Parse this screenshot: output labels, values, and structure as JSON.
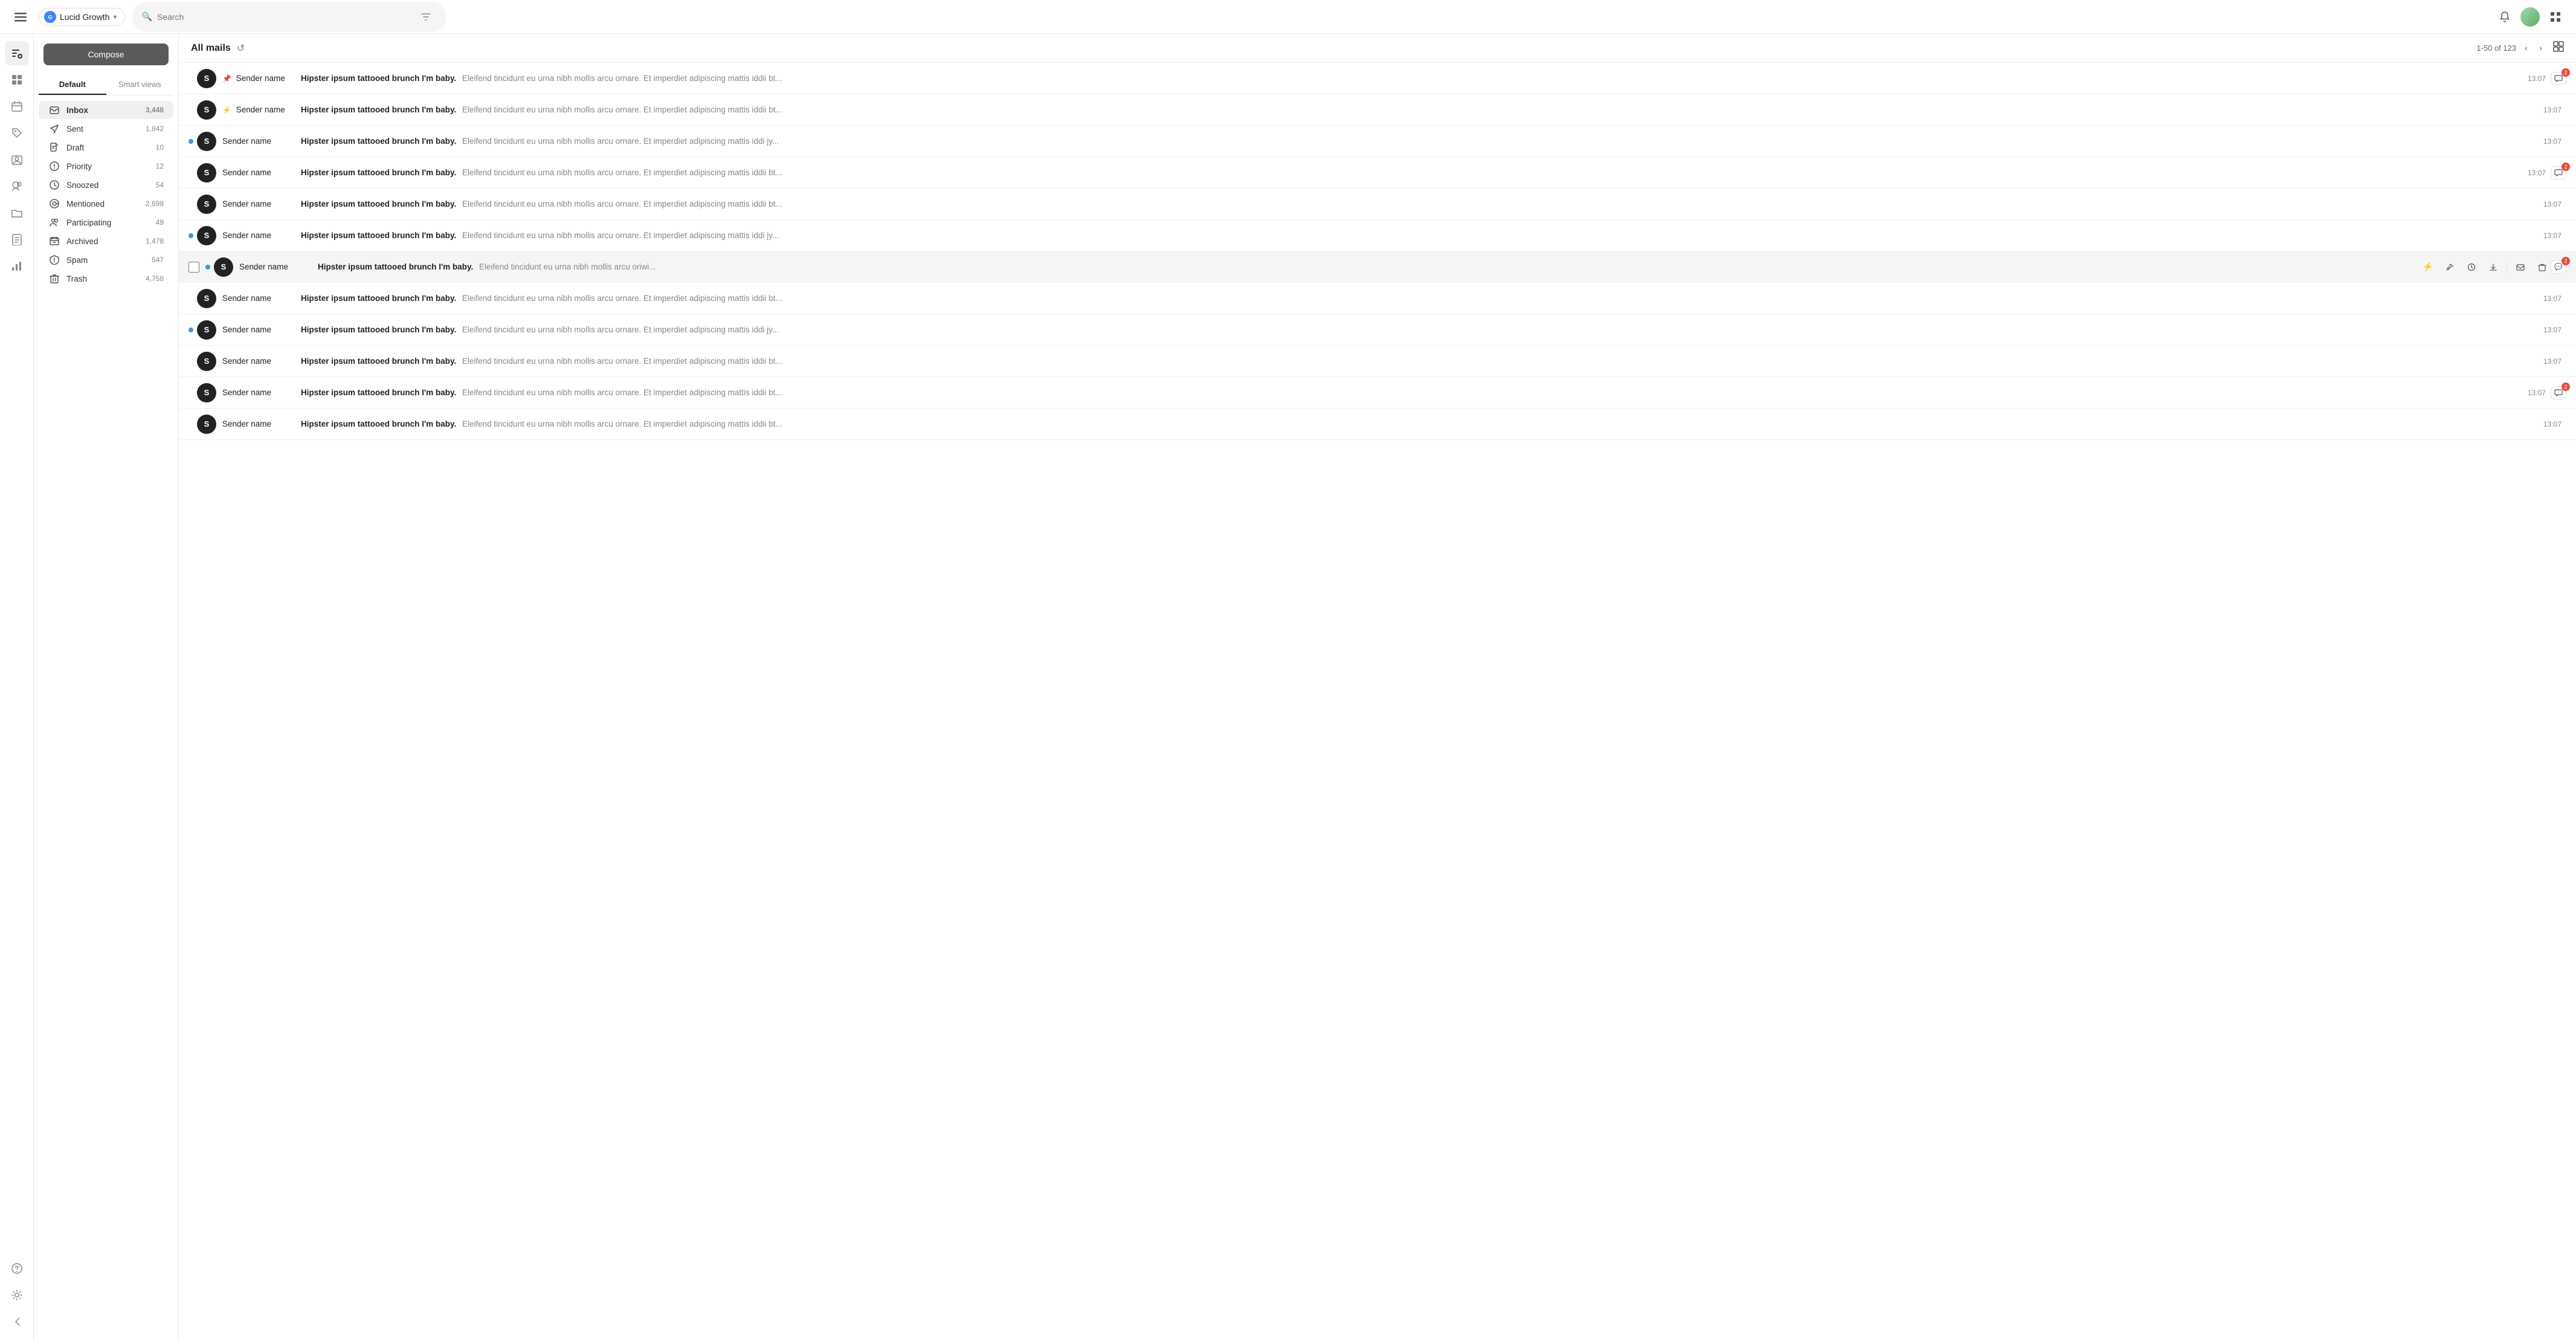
{
  "app": {
    "workspace_name": "Lucid Growth",
    "workspace_logo": "G"
  },
  "topbar": {
    "search_placeholder": "Search",
    "pagination_text": "1-50 of 123"
  },
  "sidebar": {
    "compose_label": "Compose",
    "tabs": [
      {
        "id": "default",
        "label": "Default",
        "active": true
      },
      {
        "id": "smart",
        "label": "Smart views",
        "active": false
      }
    ],
    "nav_items": [
      {
        "id": "inbox",
        "label": "Inbox",
        "count": "3,448",
        "icon": "inbox"
      },
      {
        "id": "sent",
        "label": "Sent",
        "count": "1,842",
        "icon": "sent"
      },
      {
        "id": "draft",
        "label": "Draft",
        "count": "10",
        "icon": "draft"
      },
      {
        "id": "priority",
        "label": "Priority",
        "count": "12",
        "icon": "priority"
      },
      {
        "id": "snoozed",
        "label": "Snoozed",
        "count": "54",
        "icon": "snoozed"
      },
      {
        "id": "mentioned",
        "label": "Mentioned",
        "count": "2,698",
        "icon": "mentioned"
      },
      {
        "id": "participating",
        "label": "Participating",
        "count": "49",
        "icon": "participating"
      },
      {
        "id": "archived",
        "label": "Archived",
        "count": "1,478",
        "icon": "archived"
      },
      {
        "id": "spam",
        "label": "Spam",
        "count": "547",
        "icon": "spam"
      },
      {
        "id": "trash",
        "label": "Trash",
        "count": "4,758",
        "icon": "trash"
      }
    ]
  },
  "mail_list": {
    "title": "All mails",
    "emails": [
      {
        "id": 1,
        "sender": "Sender name",
        "subject": "Hipster ipsum tattooed brunch I'm baby.",
        "preview": "Eleifend tincidunt eu urna nibh mollis arcu ornare. Et imperdiet adipiscing mattis iddii bt...",
        "time": "13:07",
        "unread": false,
        "pinned": true,
        "bolt": false,
        "comment_count": "2",
        "has_badge": true
      },
      {
        "id": 2,
        "sender": "Sender name",
        "subject": "Hipster ipsum tattooed brunch I'm baby.",
        "preview": "Eleifend tincidunt eu urna nibh mollis arcu ornare. Et imperdiet adipiscing mattis iddii bt...",
        "time": "13:07",
        "unread": false,
        "pinned": false,
        "bolt": true,
        "comment_count": null,
        "has_badge": false
      },
      {
        "id": 3,
        "sender": "Sender name",
        "subject": "Hipster ipsum tattooed brunch I'm baby.",
        "preview": "Eleifend tincidunt eu urna nibh mollis arcu ornare. Et imperdiet adipiscing mattis iddi jy...",
        "time": "13:07",
        "unread": true,
        "pinned": false,
        "bolt": false,
        "comment_count": null,
        "has_badge": false
      },
      {
        "id": 4,
        "sender": "Sender name",
        "subject": "Hipster ipsum tattooed brunch I'm baby.",
        "preview": "Eleifend tincidunt eu urna nibh mollis arcu ornare. Et imperdiet adipiscing mattis iddii bt...",
        "time": "13:07",
        "unread": false,
        "pinned": false,
        "bolt": false,
        "comment_count": "2",
        "has_badge": true
      },
      {
        "id": 5,
        "sender": "Sender name",
        "subject": "Hipster ipsum tattooed brunch I'm baby.",
        "preview": "Eleifend tincidunt eu urna nibh mollis arcu ornare. Et imperdiet adipiscing mattis iddii bt...",
        "time": "13:07",
        "unread": false,
        "pinned": false,
        "bolt": false,
        "comment_count": null,
        "has_badge": false
      },
      {
        "id": 6,
        "sender": "Sender name",
        "subject": "Hipster ipsum tattooed brunch I'm baby.",
        "preview": "Eleifend tincidunt eu urna nibh mollis arcu ornare. Et imperdiet adipiscing mattis iddi jy...",
        "time": "13:07",
        "unread": true,
        "pinned": false,
        "bolt": false,
        "comment_count": null,
        "has_badge": false
      },
      {
        "id": 7,
        "sender": "Sender name",
        "subject": "Hipster ipsum tattooed brunch I'm baby.",
        "preview": "Eleifend tincidunt eu urna nibh mollis arcu oriwi...",
        "time": null,
        "unread": true,
        "pinned": false,
        "bolt": false,
        "comment_count": "2",
        "has_badge": true,
        "hovered": true
      },
      {
        "id": 8,
        "sender": "Sender name",
        "subject": "Hipster ipsum tattooed brunch I'm baby.",
        "preview": "Eleifend tincidunt eu urna nibh mollis arcu ornare. Et imperdiet adipiscing mattis iddii bt...",
        "time": "13:07",
        "unread": false,
        "pinned": false,
        "bolt": false,
        "comment_count": null,
        "has_badge": false
      },
      {
        "id": 9,
        "sender": "Sender name",
        "subject": "Hipster ipsum tattooed brunch I'm baby.",
        "preview": "Eleifend tincidunt eu urna nibh mollis arcu ornare. Et imperdiet adipiscing mattis iddi jy...",
        "time": "13:07",
        "unread": true,
        "pinned": false,
        "bolt": false,
        "comment_count": null,
        "has_badge": false
      },
      {
        "id": 10,
        "sender": "Sender name",
        "subject": "Hipster ipsum tattooed brunch I'm baby.",
        "preview": "Eleifend tincidunt eu urna nibh mollis arcu ornare. Et imperdiet adipiscing mattis iddii bt...",
        "time": "13:07",
        "unread": false,
        "pinned": false,
        "bolt": false,
        "comment_count": null,
        "has_badge": false
      },
      {
        "id": 11,
        "sender": "Sender name",
        "subject": "Hipster ipsum tattooed brunch I'm baby.",
        "preview": "Eleifend tincidunt eu urna nibh mollis arcu ornare. Et imperdiet adipiscing mattis iddii bt...",
        "time": "13:07",
        "unread": false,
        "pinned": false,
        "bolt": false,
        "comment_count": "2",
        "has_badge": true
      },
      {
        "id": 12,
        "sender": "Sender name",
        "subject": "Hipster ipsum tattooed brunch I'm baby.",
        "preview": "Eleifend tincidunt eu urna nibh mollis arcu ornare. Et imperdiet adipiscing mattis iddii bt...",
        "time": "13:07",
        "unread": false,
        "pinned": false,
        "bolt": false,
        "comment_count": null,
        "has_badge": false
      }
    ],
    "action_labels": {
      "bolt": "⚡",
      "pin": "📌",
      "snooze": "🕐",
      "download": "⬇",
      "envelope": "✉",
      "trash": "🗑"
    }
  }
}
